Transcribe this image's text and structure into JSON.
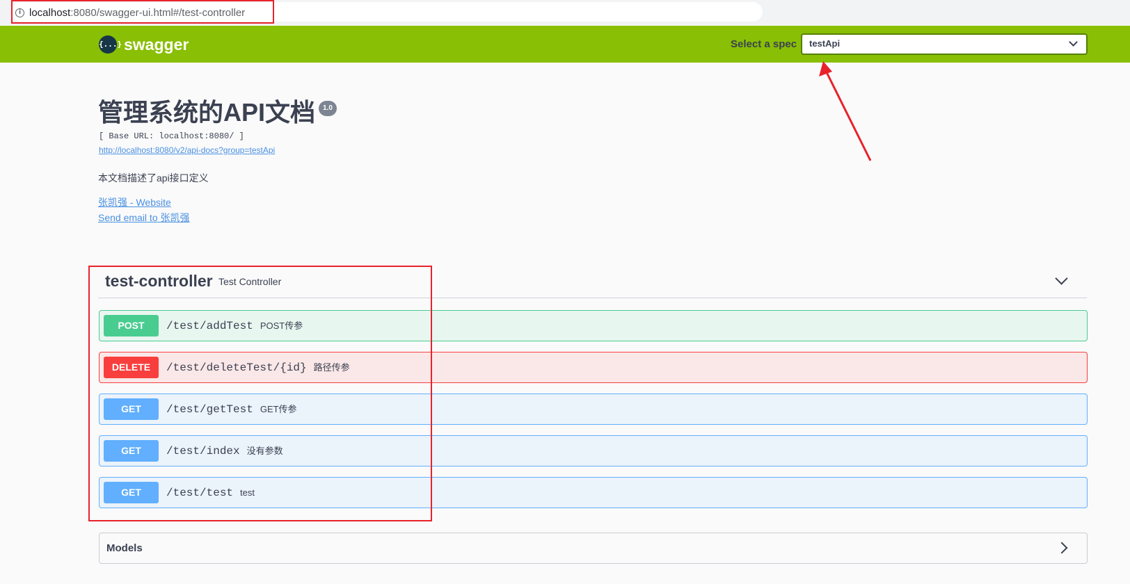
{
  "browser": {
    "url_host": "localhost",
    "url_rest": ":8080/swagger-ui.html#/test-controller",
    "info_icon": "info-icon"
  },
  "topbar": {
    "logo_glyph": "{...}",
    "logo_text": "swagger",
    "spec_label": "Select a spec",
    "spec_value": "testApi",
    "background": "#89bf04"
  },
  "info": {
    "title": "管理系统的API文档",
    "version": "1.0",
    "base_url": "[ Base URL: localhost:8080/ ]",
    "api_docs_link": "http://localhost:8080/v2/api-docs?group=testApi",
    "description": "本文档描述了api接口定义",
    "contact_website": "张凯强 - Website",
    "contact_email": "Send email to 张凯强"
  },
  "tag": {
    "name": "test-controller",
    "description": "Test Controller"
  },
  "operations": [
    {
      "method": "POST",
      "path": "/test/addTest",
      "summary": "POST传参",
      "color": "#49cc90"
    },
    {
      "method": "DELETE",
      "path": "/test/deleteTest/{id}",
      "summary": "路径传参",
      "color": "#f93e3e"
    },
    {
      "method": "GET",
      "path": "/test/getTest",
      "summary": "GET传参",
      "color": "#61affe"
    },
    {
      "method": "GET",
      "path": "/test/index",
      "summary": "没有参数",
      "color": "#61affe"
    },
    {
      "method": "GET",
      "path": "/test/test",
      "summary": "test",
      "color": "#61affe"
    }
  ],
  "models": {
    "label": "Models"
  },
  "annotation_color": "#e8222b"
}
